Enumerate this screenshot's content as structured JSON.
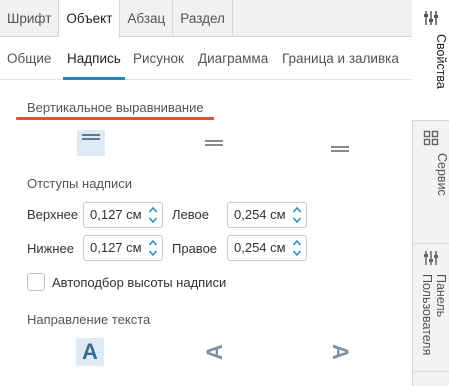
{
  "top_tabs": [
    "Шрифт",
    "Объект",
    "Абзац",
    "Раздел"
  ],
  "top_tab_active": "Объект",
  "sub_tabs": [
    "Общие",
    "Надпись",
    "Рисунок",
    "Диаграмма",
    "Граница и заливка"
  ],
  "sub_tab_active": "Надпись",
  "vertical_align": {
    "title": "Вертикальное выравнивание",
    "selected": "top",
    "options": [
      "top-align-icon",
      "middle-align-icon",
      "bottom-align-icon"
    ]
  },
  "margins": {
    "title": "Отступы надписи",
    "top_label": "Верхнее",
    "top_value": "0,127 см",
    "left_label": "Левое",
    "left_value": "0,254 см",
    "bottom_label": "Нижнее",
    "bottom_value": "0,127 см",
    "right_label": "Правое",
    "right_value": "0,254 см"
  },
  "autofit": {
    "label": "Автоподбор высоты надписи",
    "checked": false
  },
  "text_direction": {
    "title": "Направление текста",
    "glyph": "A",
    "selected": "horizontal",
    "options": [
      "horizontal-text-icon",
      "rotate-up-text-icon",
      "rotate-down-text-icon"
    ]
  },
  "sidebar": {
    "items": [
      {
        "label": "Свойства",
        "icon": "properties-sliders-icon",
        "active": true
      },
      {
        "label": "Сервис",
        "icon": "service-grid-icon",
        "active": false
      },
      {
        "label": "Панель Пользователя",
        "label_line1": "Панель",
        "label_line2": "Пользователя",
        "icon": "user-panel-sliders-icon",
        "active": false
      }
    ]
  },
  "colors": {
    "accent_blue": "#1f86c7",
    "highlight_red": "#e0542a",
    "selected_bg": "#dcebf5",
    "stepper_blue": "#2b8fd4"
  }
}
